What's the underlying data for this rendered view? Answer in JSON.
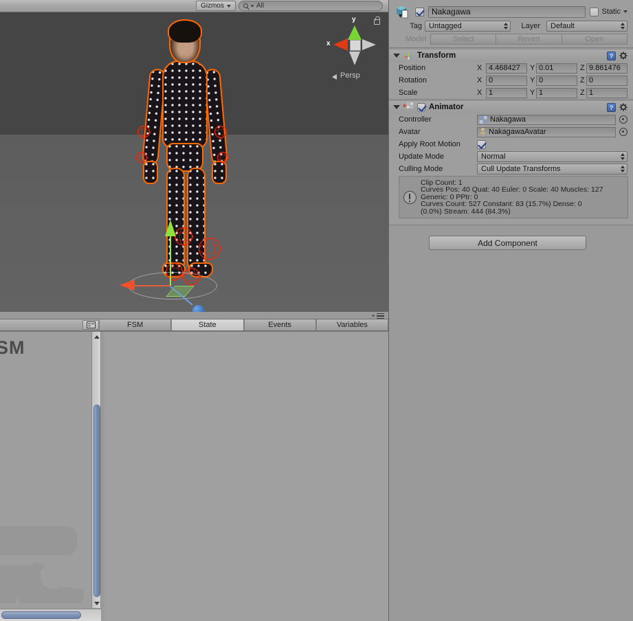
{
  "scene_view": {
    "toolbar": {
      "gizmos_label": "Gizmos",
      "search_value": "All",
      "search_placeholder": "All"
    },
    "axis_gizmo": {
      "x_label": "x",
      "y_label": "y",
      "projection": "Persp"
    }
  },
  "fsm_panel": {
    "graph_title": "SM",
    "tabs": [
      {
        "label": "FSM",
        "active": false
      },
      {
        "label": "State",
        "active": true
      },
      {
        "label": "Events",
        "active": false
      },
      {
        "label": "Variables",
        "active": false
      }
    ]
  },
  "inspector": {
    "object": {
      "name": "Nakagawa",
      "enabled": true,
      "static_label": "Static",
      "static_checked": false,
      "tag_label": "Tag",
      "tag_value": "Untagged",
      "layer_label": "Layer",
      "layer_value": "Default",
      "model_label": "Model",
      "model_buttons": [
        "Select",
        "Revert",
        "Open"
      ]
    },
    "transform": {
      "title": "Transform",
      "rows": [
        {
          "label": "Position",
          "x": "4.468427",
          "y": "0.01",
          "z": "9.861476"
        },
        {
          "label": "Rotation",
          "x": "0",
          "y": "0",
          "z": "0"
        },
        {
          "label": "Scale",
          "x": "1",
          "y": "1",
          "z": "1"
        }
      ],
      "axis_labels": [
        "X",
        "Y",
        "Z"
      ]
    },
    "animator": {
      "title": "Animator",
      "enabled": true,
      "controller_label": "Controller",
      "controller_value": "Nakagawa",
      "avatar_label": "Avatar",
      "avatar_value": "NakagawaAvatar",
      "apply_root_motion_label": "Apply Root Motion",
      "apply_root_motion_checked": true,
      "update_mode_label": "Update Mode",
      "update_mode_value": "Normal",
      "culling_mode_label": "Culling Mode",
      "culling_mode_value": "Cull Update Transforms",
      "info": "Clip Count: 1\nCurves Pos: 40 Quat: 40 Euler: 0 Scale: 40 Muscles: 127\nGeneric: 0 PPtr: 0\nCurves Count: 527 Constant: 83 (15.7%) Dense: 0\n(0.0%) Stream: 444 (84.3%)"
    },
    "add_component_label": "Add Component"
  },
  "colors": {
    "panel_bg": "#9a9a9a",
    "sky": "#454545",
    "ground": "#5f5f5f",
    "selection_outline": "#ff6a00",
    "gizmo_x": "#f2502a",
    "gizmo_y": "#8fe03d",
    "gizmo_z": "#2c62b8",
    "collider_wire": "#ff2200",
    "scrollbar_thumb": "#7a8fb2"
  }
}
